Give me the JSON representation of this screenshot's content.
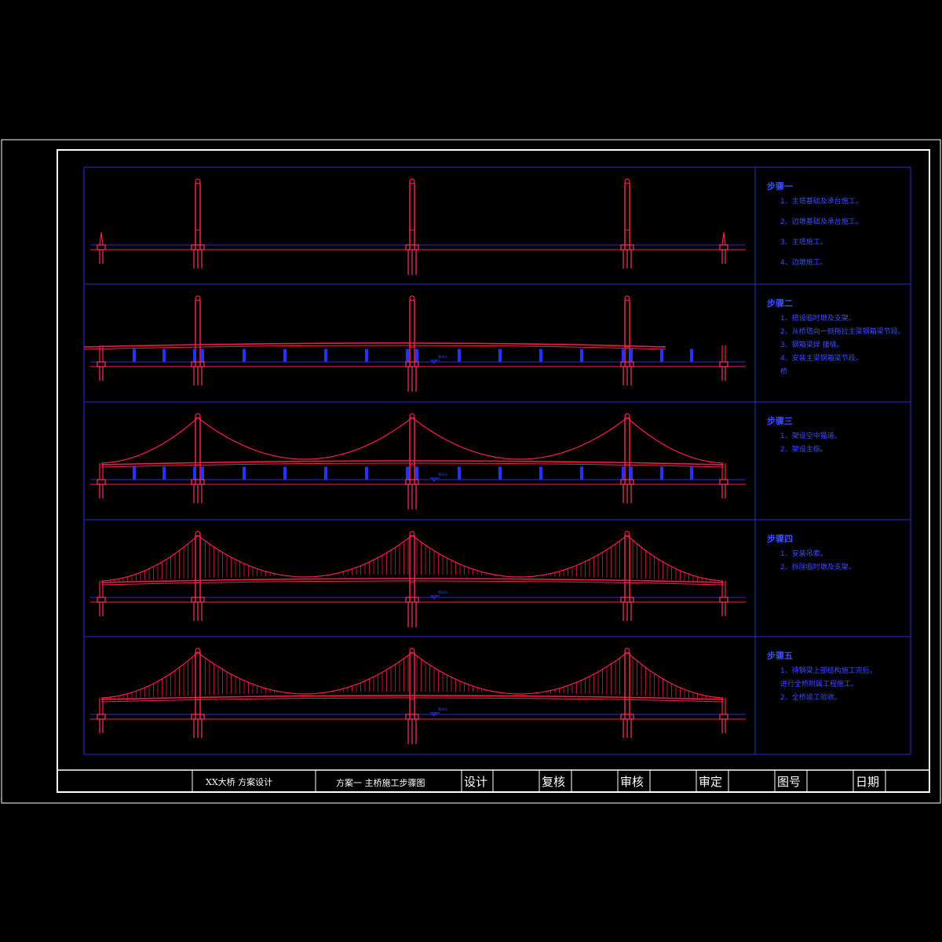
{
  "colors": {
    "background": "#000000",
    "frame": "#ffffff",
    "grid": "#2a2ad8",
    "structure": "#ff1a4a",
    "pier": "#ff3366",
    "support": "#2233ff",
    "note_text": "#3a4cff",
    "titleblock_text": "#ffffff"
  },
  "steps": [
    {
      "stage": "towers",
      "title": "步骤一",
      "items": [
        "1、主塔基础及承台施工。",
        "2、边墩基础及承台施工。",
        "3、主塔施工。",
        "4、边墩施工。"
      ]
    },
    {
      "stage": "girder",
      "title": "步骤二",
      "items": [
        "1、搭设临时墩及支架。",
        "2、从桥塔向一侧拖拉主梁钢箱梁节段。",
        "3、钢箱梁焊 接缝。",
        "4、安装主梁钢箱梁节段。",
        "桥"
      ]
    },
    {
      "stage": "cables",
      "title": "步骤三",
      "items": [
        "1、架设空中猫道。",
        "2、架设主缆。"
      ]
    },
    {
      "stage": "hangers",
      "title": "步骤四",
      "items": [
        "1、安装吊索。",
        "2、拆除临时墩及支架。"
      ]
    },
    {
      "stage": "complete",
      "title": "步骤五",
      "items": [
        "1、待钢梁上部结构施工完后，",
        "   进行全桥附属工程施工。",
        "2、全桥竣工验收。"
      ]
    }
  ],
  "water_tag": "常水位",
  "title_block": {
    "project": "XX大桥  方案设计",
    "drawing_title": "方案一 主桥施工步骤图",
    "fields": [
      "设计",
      "复核",
      "审核",
      "审定",
      "图号",
      "日期"
    ]
  }
}
